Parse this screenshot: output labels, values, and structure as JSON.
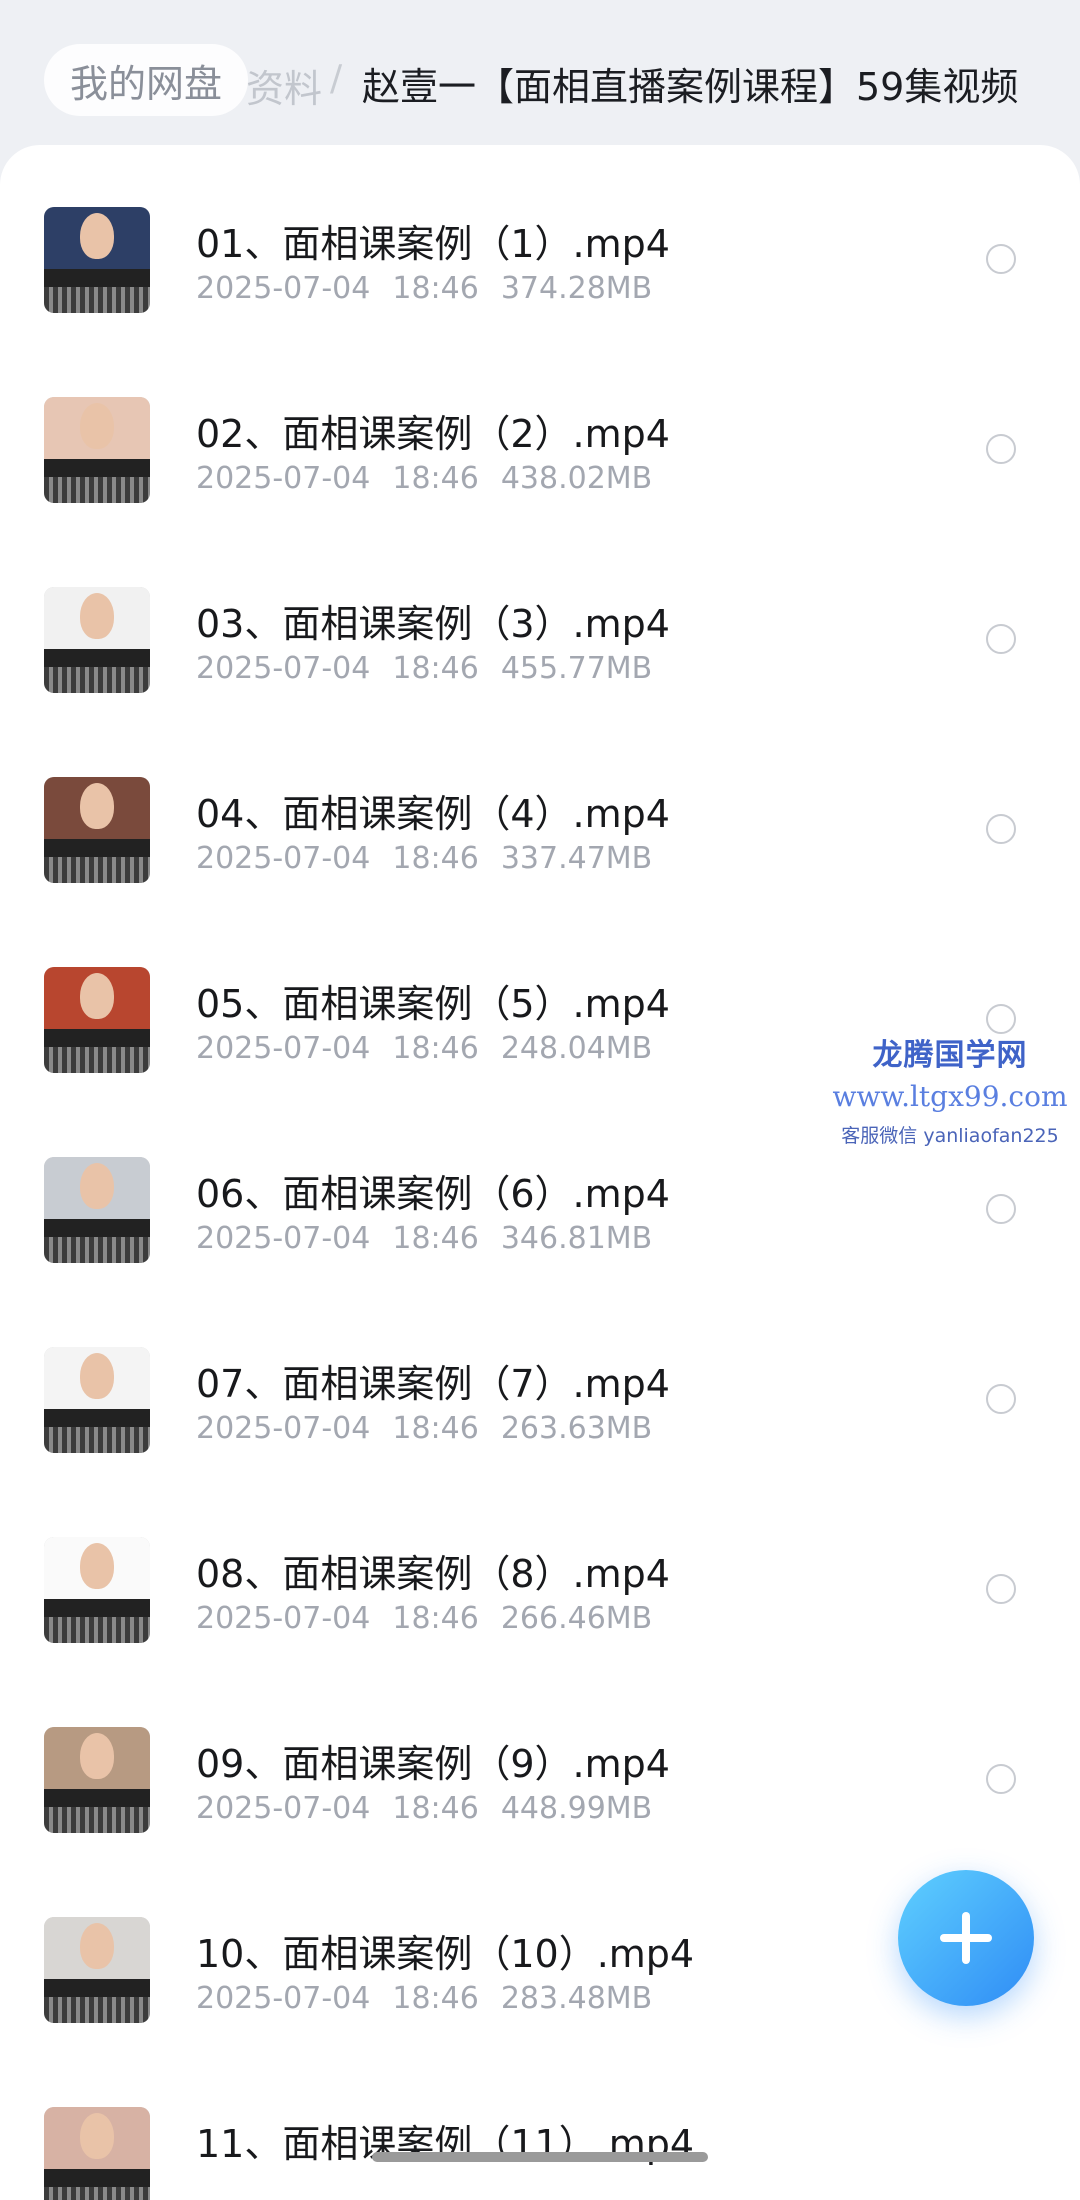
{
  "breadcrumb": {
    "home": "我的网盘",
    "middle": "资料",
    "separator": "/",
    "current": "赵壹一【面相直播案例课程】59集视频"
  },
  "files": [
    {
      "name": "01、面相课案例（1）.mp4",
      "date": "2025-07-04",
      "time": "18:46",
      "size": "374.28MB"
    },
    {
      "name": "02、面相课案例（2）.mp4",
      "date": "2025-07-04",
      "time": "18:46",
      "size": "438.02MB"
    },
    {
      "name": "03、面相课案例（3）.mp4",
      "date": "2025-07-04",
      "time": "18:46",
      "size": "455.77MB"
    },
    {
      "name": "04、面相课案例（4）.mp4",
      "date": "2025-07-04",
      "time": "18:46",
      "size": "337.47MB"
    },
    {
      "name": "05、面相课案例（5）.mp4",
      "date": "2025-07-04",
      "time": "18:46",
      "size": "248.04MB"
    },
    {
      "name": "06、面相课案例（6）.mp4",
      "date": "2025-07-04",
      "time": "18:46",
      "size": "346.81MB"
    },
    {
      "name": "07、面相课案例（7）.mp4",
      "date": "2025-07-04",
      "time": "18:46",
      "size": "263.63MB"
    },
    {
      "name": "08、面相课案例（8）.mp4",
      "date": "2025-07-04",
      "time": "18:46",
      "size": "266.46MB"
    },
    {
      "name": "09、面相课案例（9）.mp4",
      "date": "2025-07-04",
      "time": "18:46",
      "size": "448.99MB"
    },
    {
      "name": "10、面相课案例（10）.mp4",
      "date": "2025-07-04",
      "time": "18:46",
      "size": "283.48MB"
    },
    {
      "name": "11、面相课案例（11）.mp4",
      "date": "",
      "time": "",
      "size": ""
    }
  ],
  "watermark": {
    "title": "龙腾国学网",
    "url": "www.ltgx99.com",
    "contact": "客服微信 yanliaofan225"
  },
  "fab": {
    "icon": "plus-icon"
  },
  "colors": {
    "accent": "#2f8cf5",
    "fab_light": "#5fd0ff",
    "meta_text": "#a3a7b0",
    "watermark": "#3f63c8"
  }
}
